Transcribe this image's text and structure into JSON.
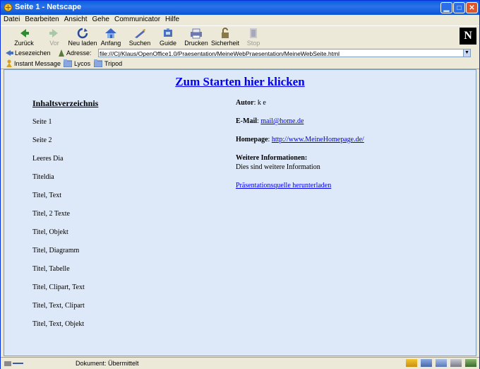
{
  "window": {
    "title": "Seite 1 - Netscape"
  },
  "menu": [
    {
      "label": "Datei"
    },
    {
      "label": "Bearbeiten"
    },
    {
      "label": "Ansicht"
    },
    {
      "label": "Gehe"
    },
    {
      "label": "Communicator"
    },
    {
      "label": "Hilfe"
    }
  ],
  "toolbar": {
    "back": "Zurück",
    "forward": "Vor",
    "reload": "Neu laden",
    "home": "Anfang",
    "search": "Suchen",
    "guide": "Guide",
    "print": "Drucken",
    "security": "Sicherheit",
    "stop": "Stop"
  },
  "location": {
    "bookmarks_label": "Lesezeichen",
    "address_label": "Adresse:",
    "url": "file:///C|/Klaus/OpenOffice1.0/Praesentation/MeineWebPraesentation/MeineWebSeite.html"
  },
  "personal": {
    "instant_message": "Instant Message",
    "lycos": "Lycos",
    "tripod": "Tripod"
  },
  "page": {
    "start_link": "Zum Starten hier klicken",
    "toc_title": "Inhaltsverzeichnis",
    "toc_items": [
      "Seite 1",
      "Seite 2",
      "Leeres Dia",
      "Titeldia",
      "Titel, Text",
      "Titel, 2 Texte",
      "Titel, Objekt",
      "Titel, Diagramm",
      "Titel, Tabelle",
      "Titel, Clipart, Text",
      "Titel, Text, Clipart",
      "Titel, Text, Objekt"
    ],
    "author_label": "Autor",
    "author_value": "k e",
    "email_label": "E-Mail",
    "email_value": "mail@home.de",
    "homepage_label": "Homepage",
    "homepage_value": "http://www.MeineHomepage.de/",
    "more_info_label": "Weitere Informationen:",
    "more_info_text": "Dies sind weitere Information",
    "download_link": "Präsentationsquelle herunterladen"
  },
  "status": {
    "text": "Dokument: Übermittelt"
  },
  "colors": {
    "link": "#0000ee",
    "content_bg": "#dde8f8",
    "titlebar": "#0a5fdf"
  }
}
